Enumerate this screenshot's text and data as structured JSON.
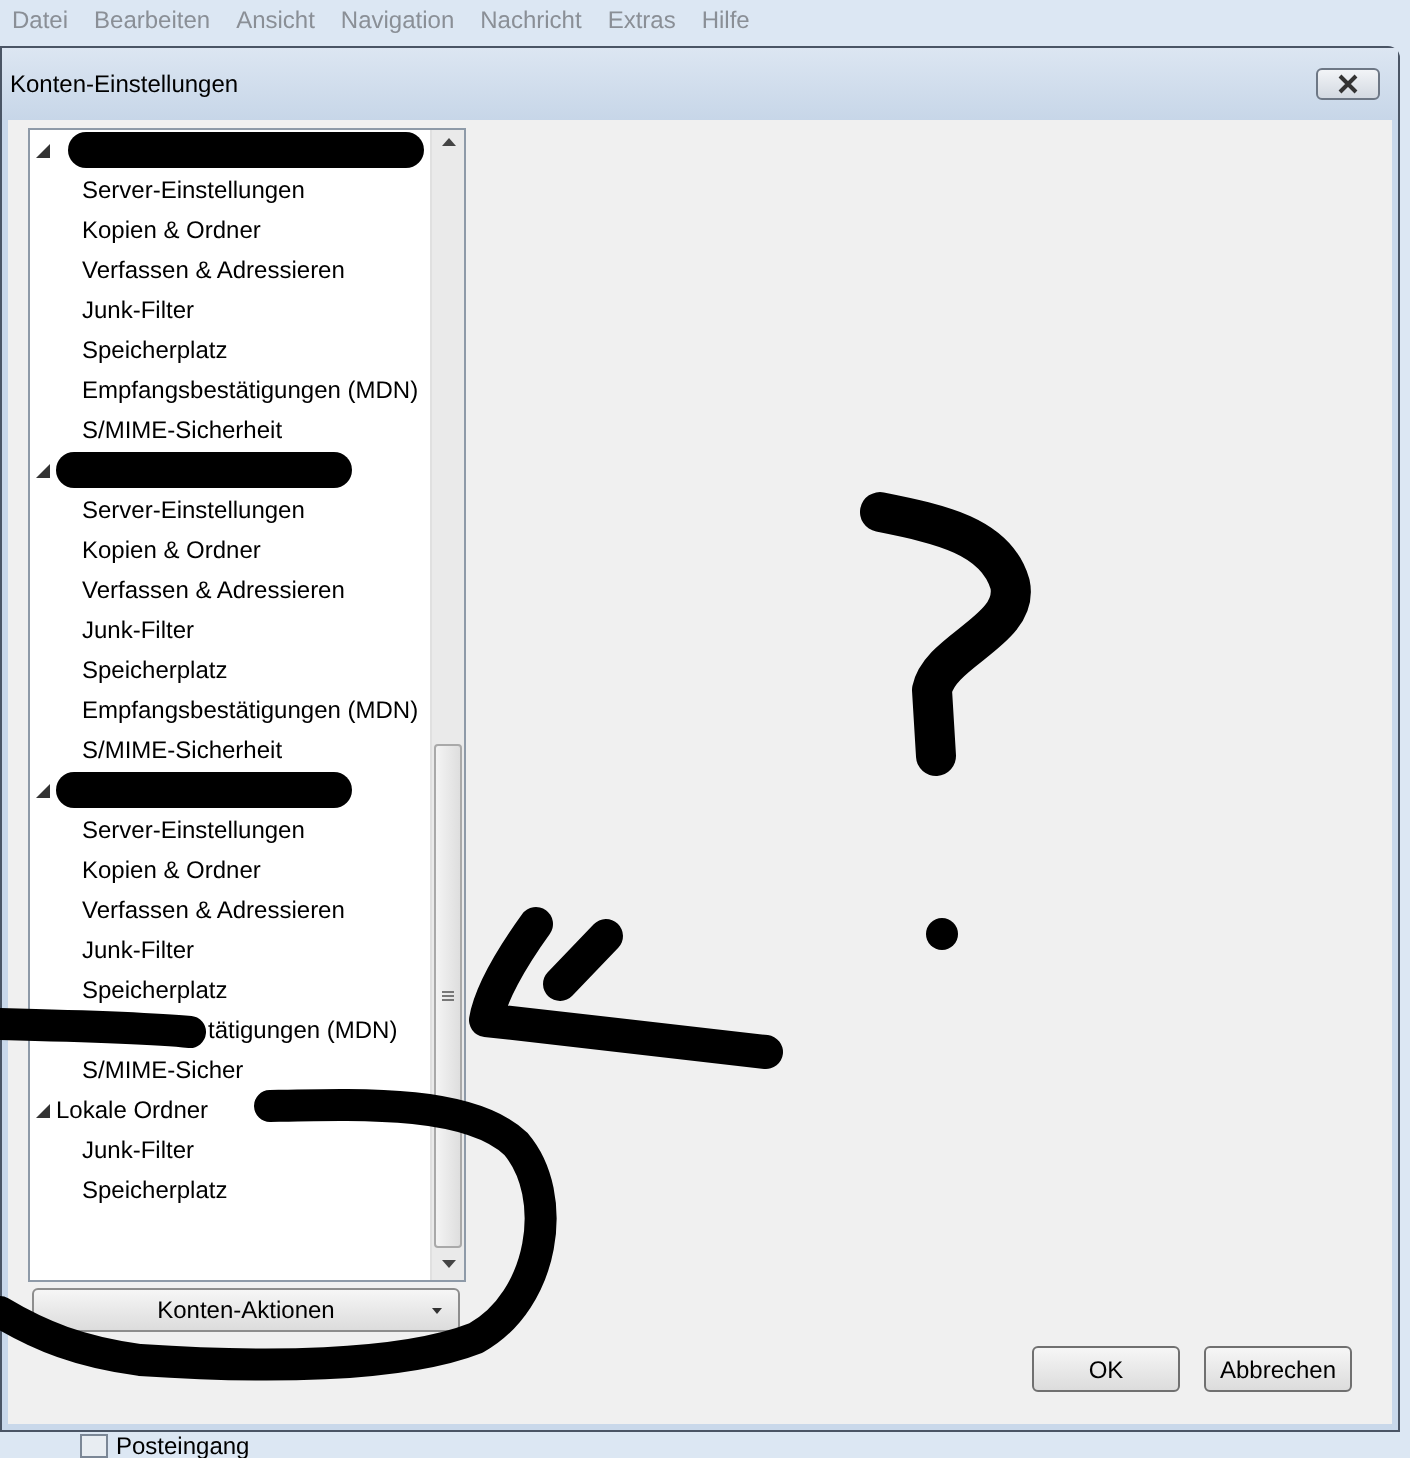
{
  "menu": [
    "Datei",
    "Bearbeiten",
    "Ansicht",
    "Navigation",
    "Nachricht",
    "Extras",
    "Hilfe"
  ],
  "dialog": {
    "title": "Konten-Einstellungen",
    "tree": [
      {
        "kind": "redacted",
        "expanded": true,
        "children": [
          {
            "label": "Server-Einstellungen"
          },
          {
            "label": "Kopien & Ordner"
          },
          {
            "label": "Verfassen & Adressieren"
          },
          {
            "label": "Junk-Filter"
          },
          {
            "label": "Speicherplatz"
          },
          {
            "label": "Empfangsbestätigungen (MDN)"
          },
          {
            "label": "S/MIME-Sicherheit"
          }
        ]
      },
      {
        "kind": "redacted",
        "expanded": true,
        "children": [
          {
            "label": "Server-Einstellungen"
          },
          {
            "label": "Kopien & Ordner"
          },
          {
            "label": "Verfassen & Adressieren"
          },
          {
            "label": "Junk-Filter"
          },
          {
            "label": "Speicherplatz"
          },
          {
            "label": "Empfangsbestätigungen (MDN)"
          },
          {
            "label": "S/MIME-Sicherheit"
          }
        ]
      },
      {
        "kind": "redacted",
        "expanded": true,
        "children": [
          {
            "label": "Server-Einstellungen"
          },
          {
            "label": "Kopien & Ordner"
          },
          {
            "label": "Verfassen & Adressieren"
          },
          {
            "label": "Junk-Filter"
          },
          {
            "label": "Speicherplatz"
          },
          {
            "label": "tätigungen (MDN)",
            "kind": "cut_start"
          },
          {
            "label": "S/MIME-Sicher"
          }
        ]
      },
      {
        "kind": "folder",
        "label": "Lokale Ordner",
        "expanded": true,
        "children": [
          {
            "label": "Junk-Filter"
          },
          {
            "label": "Speicherplatz"
          }
        ]
      }
    ],
    "actions_button": "Konten-Aktionen",
    "buttons": [
      "OK",
      "Abbrechen"
    ]
  },
  "background_item": "Posteingang"
}
